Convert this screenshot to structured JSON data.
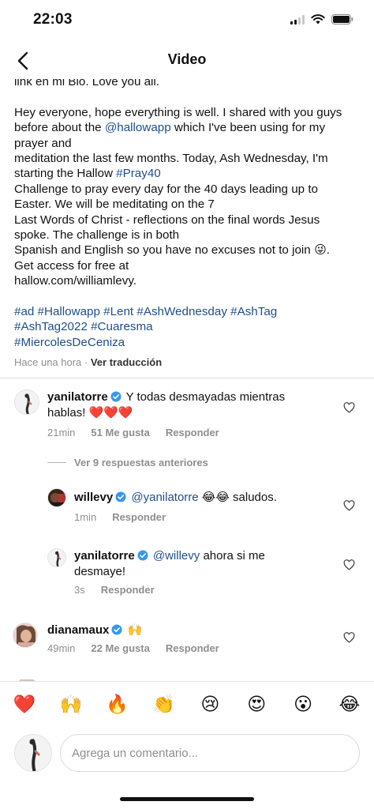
{
  "status": {
    "time": "22:03"
  },
  "header": {
    "title": "Video"
  },
  "caption": {
    "lines": [
      [
        {
          "t": "link en mi Bio.  Love you all."
        }
      ],
      [
        {
          "t": ""
        }
      ],
      [
        {
          "t": "Hey everyone, hope everything is well. I shared with you guys"
        }
      ],
      [
        {
          "t": "before about the "
        },
        {
          "t": "@hallowapp",
          "k": "mention"
        },
        {
          "t": " which I've been using for my"
        }
      ],
      [
        {
          "t": "prayer and"
        }
      ],
      [
        {
          "t": " meditation the last few months. Today, Ash Wednesday, I'm"
        }
      ],
      [
        {
          "t": "starting the Hallow "
        },
        {
          "t": "#Pray40",
          "k": "tag"
        }
      ],
      [
        {
          "t": " Challenge to pray every day for the 40 days leading up to"
        }
      ],
      [
        {
          "t": "Easter. We will be meditating on the 7"
        }
      ],
      [
        {
          "t": " Last Words of Christ - reflections on the final words Jesus"
        }
      ],
      [
        {
          "t": "spoke. The challenge is in both"
        }
      ],
      [
        {
          "t": " Spanish and English so you have no excuses not to join 😜."
        }
      ],
      [
        {
          "t": "Get access for free at"
        }
      ],
      [
        {
          "t": " hallow.com/williamlevy."
        }
      ],
      [
        {
          "t": ""
        }
      ],
      [
        {
          "t": " "
        },
        {
          "t": "#ad #Hallowapp #Lent #AshWednesday #AshTag",
          "k": "tag"
        }
      ],
      [
        {
          "t": "#AshTag2022 #Cuaresma",
          "k": "tag"
        }
      ],
      [
        {
          "t": " "
        },
        {
          "t": "#MiercolesDeCeniza",
          "k": "tag"
        }
      ]
    ],
    "time": "Hace una hora",
    "separator": " · ",
    "translate": "Ver traducción"
  },
  "comments": [
    {
      "username": "yanilatorre",
      "text": "Y todas desmayadas mientras",
      "text2": "hablas! ❤️❤️❤️",
      "time": "21min",
      "likes": "51 Me gusta",
      "reply": "Responder"
    },
    {
      "username": "willevy",
      "mention": "@yanilatorre",
      "text": " 😂😂 saludos.",
      "time": "1min",
      "reply": "Responder"
    },
    {
      "username": "yanilatorre",
      "mention": "@willevy",
      "text": " ahora si me",
      "text2": "desmaye!",
      "time": "3s",
      "reply": "Responder"
    },
    {
      "username": "dianamaux",
      "text": "🙌",
      "time": "49min",
      "likes": "22 Me gusta",
      "reply": "Responder"
    }
  ],
  "view_replies": "Ver 9 respuestas anteriores",
  "emojis": [
    "❤️",
    "🙌",
    "🔥",
    "👏",
    "😢",
    "😍",
    "😮",
    "😂"
  ],
  "compose": {
    "placeholder": "Agrega un comentario..."
  },
  "colors": {
    "link": "#1f4e8c",
    "verified": "#3897f0",
    "heart": "#ed1c24",
    "muted": "#8e8e8e"
  }
}
